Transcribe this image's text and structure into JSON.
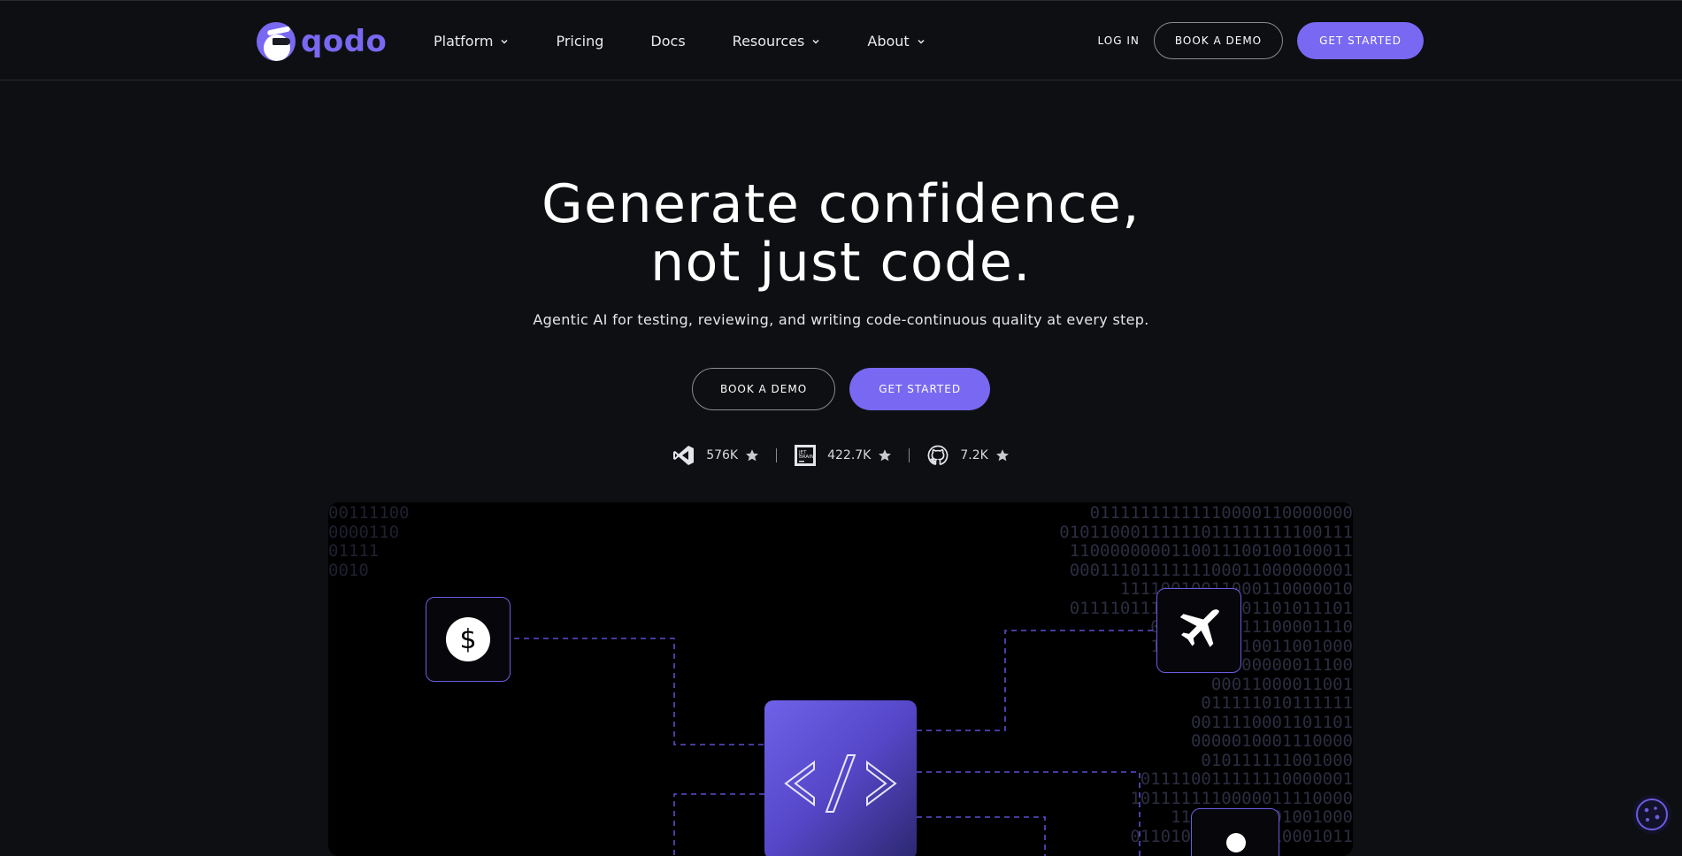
{
  "brand": {
    "name": "qodo",
    "accent": "#7968f1"
  },
  "nav": {
    "links": [
      {
        "label": "Platform",
        "dropdown": true
      },
      {
        "label": "Pricing",
        "dropdown": false
      },
      {
        "label": "Docs",
        "dropdown": false
      },
      {
        "label": "Resources",
        "dropdown": true
      },
      {
        "label": "About",
        "dropdown": true
      }
    ],
    "login": "LOG IN",
    "book_demo": "BOOK A DEMO",
    "get_started": "GET STARTED"
  },
  "hero": {
    "title_line1": "Generate confidence,",
    "title_line2": "not just code.",
    "subtitle": "Agentic AI for testing, reviewing, and writing code-continuous quality at every step.",
    "book_demo": "BOOK A DEMO",
    "get_started": "GET STARTED"
  },
  "stats": [
    {
      "icon": "vscode-icon",
      "value": "576K"
    },
    {
      "icon": "jetbrains-icon",
      "value": "422.7K"
    },
    {
      "icon": "github-icon",
      "value": "7.2K"
    }
  ],
  "showcase": {
    "code_symbol": "</>",
    "binary_right": [
      "01111111111110000110000000",
      "01011000111111011111111100111",
      "1100000000110011100100100011",
      "0001110111111100011000000001",
      "11110010011000110000010",
      "0111101111111000101101011101",
      "01010000011100001110",
      "10101001110011001000",
      "111110000000011100",
      "00011000011001",
      "011111010111111",
      "0011110001101101",
      "0000010001110000",
      "010111111001000",
      "011110011111110000001",
      "1011111110000011110000",
      "111011110001001000",
      "0110100001011110001011"
    ],
    "binary_left": [
      "00111100",
      "0000110",
      "01111",
      "0010"
    ]
  }
}
